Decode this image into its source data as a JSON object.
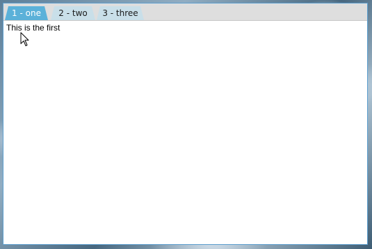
{
  "tabs": [
    {
      "label": "1 - one",
      "active": true
    },
    {
      "label": "2 - two",
      "active": false
    },
    {
      "label": "3 - three",
      "active": false
    }
  ],
  "content": {
    "text": "This is the first"
  },
  "colors": {
    "active_tab": "#5bb1d9",
    "inactive_tab": "#c9dfe9",
    "window_border": "#5d9fcf",
    "tab_strip": "#dedede"
  },
  "icons": {
    "cursor": "mouse-pointer-icon"
  }
}
